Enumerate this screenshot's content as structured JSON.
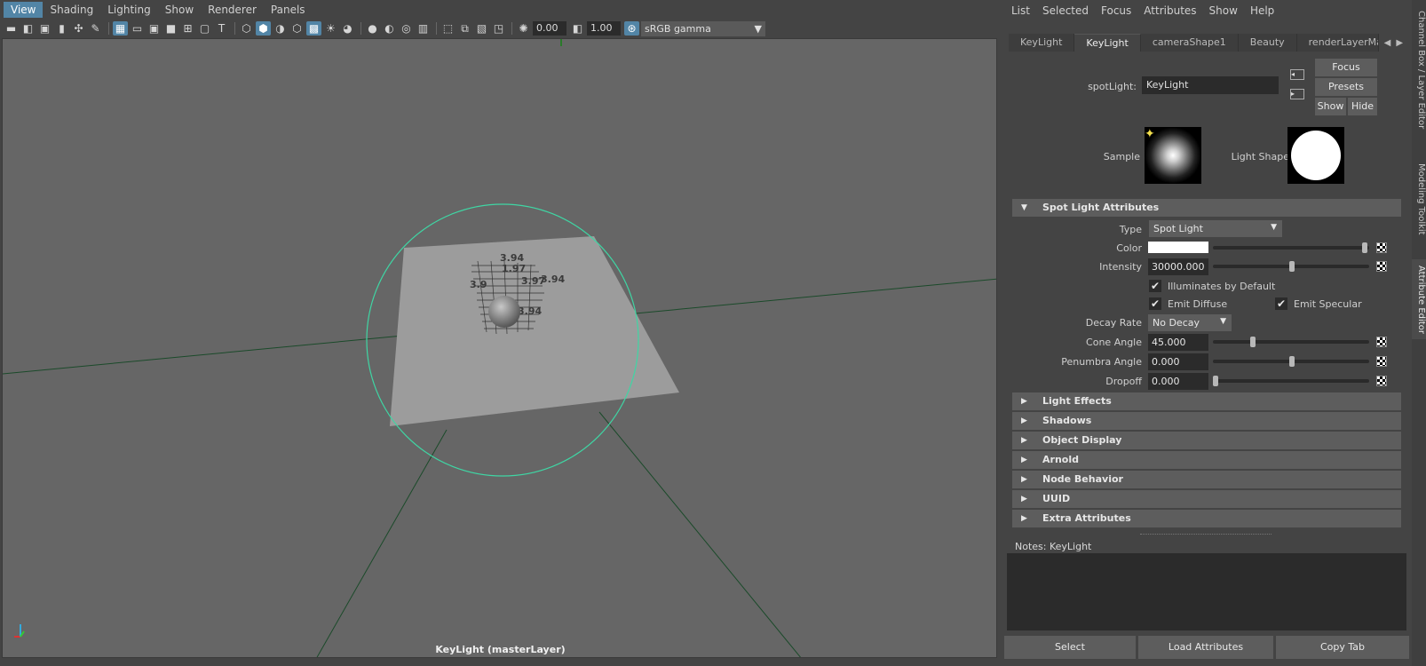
{
  "viewport": {
    "menus": [
      "View",
      "Shading",
      "Lighting",
      "Show",
      "Renderer",
      "Panels"
    ],
    "active_menu": "View",
    "exposure": "0.00",
    "gamma": "1.00",
    "color_space": "sRGB gamma",
    "caption": "KeyLight (masterLayer)",
    "scene_labels": [
      "3.94",
      "1.97",
      "3.9",
      "3.97",
      "3.94",
      "3.94"
    ],
    "colors": {
      "background": "#666666",
      "plane": "#9c9c9c",
      "cone": "#3fd6a4",
      "grid": "#1b4a2a"
    }
  },
  "attribute_editor": {
    "menus": [
      "List",
      "Selected",
      "Focus",
      "Attributes",
      "Show",
      "Help"
    ],
    "tabs": [
      "KeyLight",
      "KeyLight",
      "cameraShape1",
      "Beauty",
      "renderLayerMan"
    ],
    "active_tab": 1,
    "node_type_label": "spotLight:",
    "node_name": "KeyLight",
    "buttons": {
      "focus": "Focus",
      "presets": "Presets",
      "show": "Show",
      "hide": "Hide"
    },
    "sample_label": "Sample",
    "light_shape_label": "Light Shape",
    "spot_section": {
      "title": "Spot Light Attributes",
      "type_label": "Type",
      "type_value": "Spot Light",
      "color_label": "Color",
      "color_value": "#ffffff",
      "intensity_label": "Intensity",
      "intensity_value": "30000.000",
      "illuminates_label": "Illuminates by Default",
      "emit_diffuse_label": "Emit Diffuse",
      "emit_specular_label": "Emit Specular",
      "decay_label": "Decay Rate",
      "decay_value": "No Decay",
      "cone_label": "Cone Angle",
      "cone_value": "45.000",
      "penumbra_label": "Penumbra Angle",
      "penumbra_value": "0.000",
      "dropoff_label": "Dropoff",
      "dropoff_value": "0.000"
    },
    "collapsed_sections": [
      "Light Effects",
      "Shadows",
      "Object Display",
      "Arnold",
      "Node Behavior",
      "UUID",
      "Extra Attributes"
    ],
    "notes_label": "Notes:  KeyLight",
    "bottom_buttons": {
      "select": "Select",
      "load": "Load Attributes",
      "copy": "Copy Tab"
    }
  },
  "side_tabs": [
    "Channel Box / Layer Editor",
    "Modeling Toolkit",
    "Attribute Editor"
  ]
}
